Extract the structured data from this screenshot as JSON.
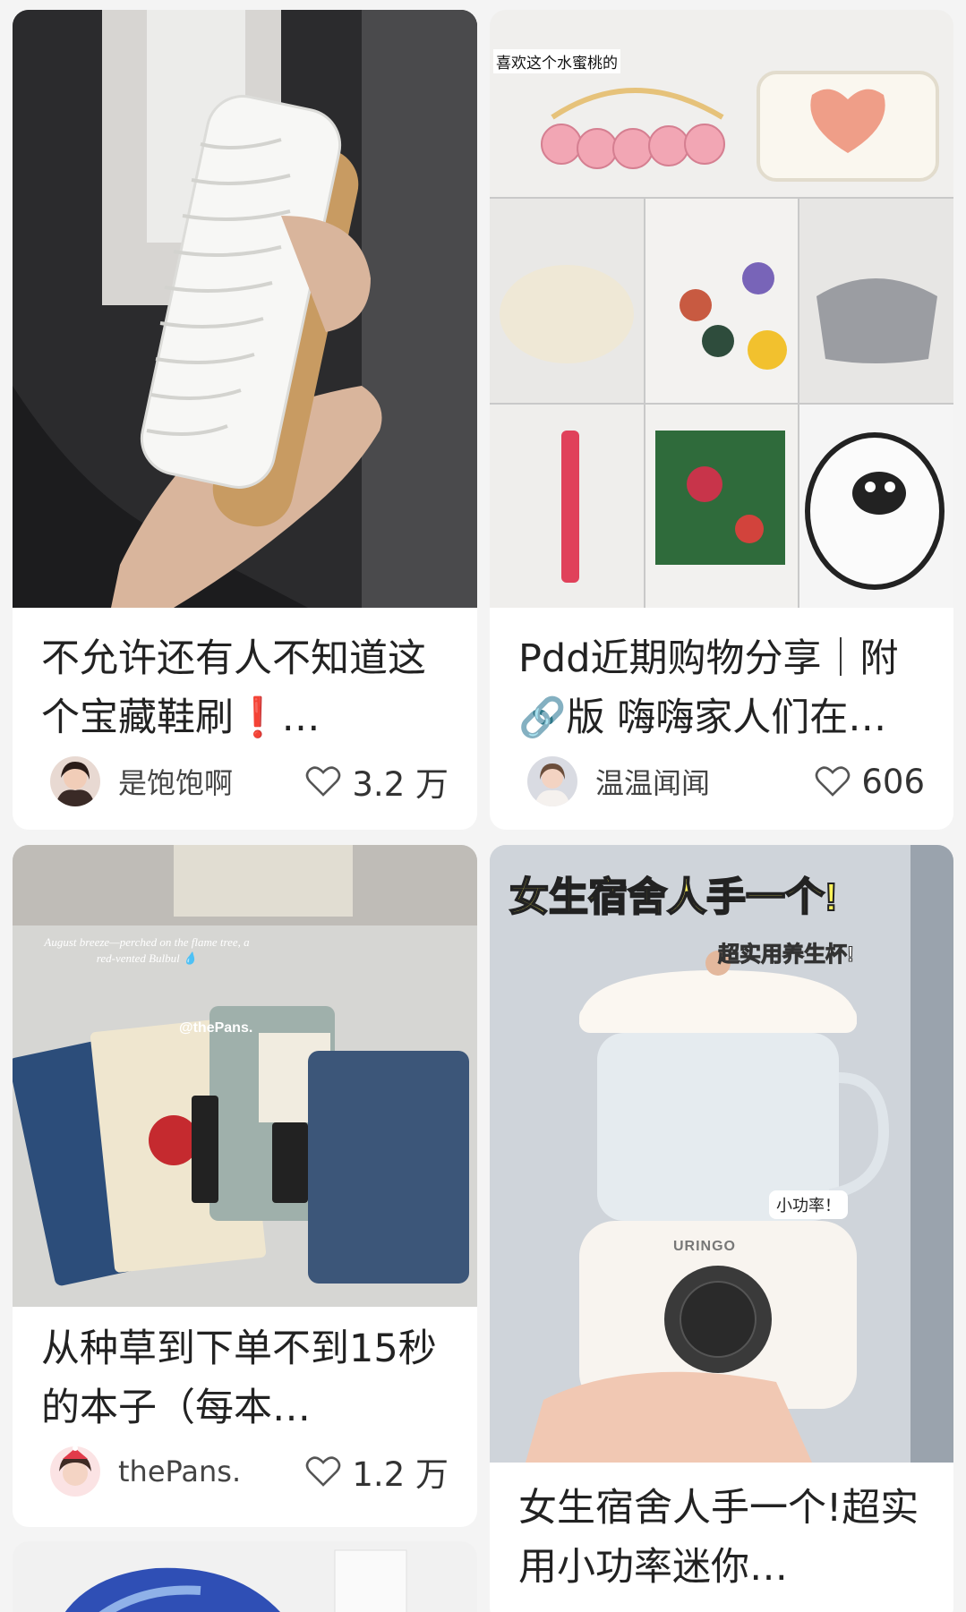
{
  "feed": {
    "cards": [
      {
        "title": "不允许还有人不知道这个宝藏鞋刷❗️…",
        "author": "是饱饱啊",
        "likes": "3.2 万"
      },
      {
        "title": "Pdd近期购物分享｜附🔗版 嗨嗨家人们在…",
        "author": "温温闻闻",
        "likes": "606",
        "cover_caption": "喜欢这个水蜜桃的"
      },
      {
        "title": "从种草到下单不到15秒的本子（每本…",
        "author": "thePans.",
        "likes": "1.2 万",
        "cover_caption": "August breeze—perched on the flame tree, a red-vented Bulbul 💧",
        "watermark": "@thePans."
      },
      {
        "title": "女生宿舍人手一个!超实用小功率迷你…",
        "cover_headline": "女生宿舍人手一个!",
        "cover_subhead": "超实用养生杯!",
        "cover_tag": "小功率！",
        "cover_brand": "URINGO"
      }
    ]
  },
  "colors": {
    "background": "#f4f4f4",
    "card": "#ffffff",
    "text": "#222222",
    "headline_yellow": "#fff35a"
  }
}
